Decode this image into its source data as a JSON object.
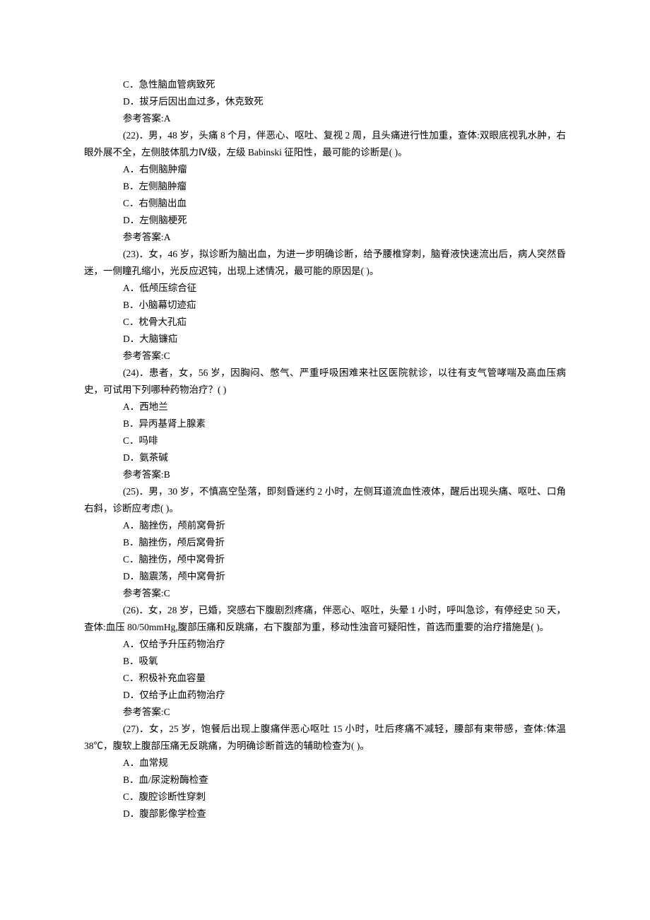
{
  "pre_options": [
    "C．急性脑血管病致死",
    "D．拔牙后因出血过多，休克致死"
  ],
  "pre_answer": "参考答案:A",
  "questions": [
    {
      "num": "(22)",
      "stem": "．男，48 岁，头痛 8 个月，伴恶心、呕吐、复视 2 周，且头痛进行性加重，查体:双眼底视乳水肿，右眼外展不全，左侧肢体肌力Ⅳ级，左级 Babinski 征阳性，最可能的诊断是( )。",
      "options": [
        "A．右侧脑肿瘤",
        "B．左侧脑肿瘤",
        "C．右侧脑出血",
        "D．左侧脑梗死"
      ],
      "answer": "参考答案:A"
    },
    {
      "num": "(23)",
      "stem": "．女，46 岁，拟诊断为脑出血，为进一步明确诊断，给予腰椎穿刺，脑脊液快速流出后，病人突然昏迷，一侧瞳孔缩小，光反应迟钝，出现上述情况，最可能的原因是( )。",
      "options": [
        "A．低颅压综合征",
        "B．小脑幕切迹疝",
        "C．枕骨大孔疝",
        "D．大脑镰疝"
      ],
      "answer": "参考答案:C"
    },
    {
      "num": "(24)",
      "stem": "．患者，女，56 岁，因胸闷、憋气、严重呼吸困难来社区医院就诊，以往有支气管哮喘及高血压病史，可试用下列哪种药物治疗？( )",
      "options": [
        "A．西地兰",
        "B．异丙基肾上腺素",
        "C．吗啡",
        "D．氨茶碱"
      ],
      "answer": "参考答案:B"
    },
    {
      "num": "(25)",
      "stem": "．男，30 岁，不慎高空坠落，即刻昏迷约 2 小时，左侧耳道流血性液体，醒后出现头痛、呕吐、口角右斜，诊断应考虑( )。",
      "options": [
        "A．脑挫伤，颅前窝骨折",
        "B．脑挫伤，颅后窝骨折",
        "C．脑挫伤，颅中窝骨折",
        "D．脑震荡，颅中窝骨折"
      ],
      "answer": "参考答案:C"
    },
    {
      "num": "(26)",
      "stem": "．女，28 岁，已婚，突感右下腹剧烈疼痛，伴恶心、呕吐，头晕 1 小时，呼叫急诊，有停经史 50 天，查体:血压 80/50mmHg,腹部压痛和反跳痛，右下腹部为重，移动性浊音可疑阳性，首选而重要的治疗措施是( )。",
      "options": [
        "A．仅给予升压药物治疗",
        "B．吸氧",
        "C．积极补充血容量",
        "D．仅给予止血药物治疗"
      ],
      "answer": "参考答案:C"
    },
    {
      "num": "(27)",
      "stem": "．女，25 岁，饱餐后出现上腹痛伴恶心呕吐 15 小时，吐后疼痛不减轻，腰部有束带感，查体:体温38℃，腹软上腹部压痛无反跳痛，为明确诊断首选的辅助检查为( )。",
      "options": [
        "A．血常规",
        "B．血/尿淀粉酶检查",
        "C．腹腔诊断性穿刺",
        "D．腹部影像学检查"
      ],
      "answer": ""
    }
  ]
}
